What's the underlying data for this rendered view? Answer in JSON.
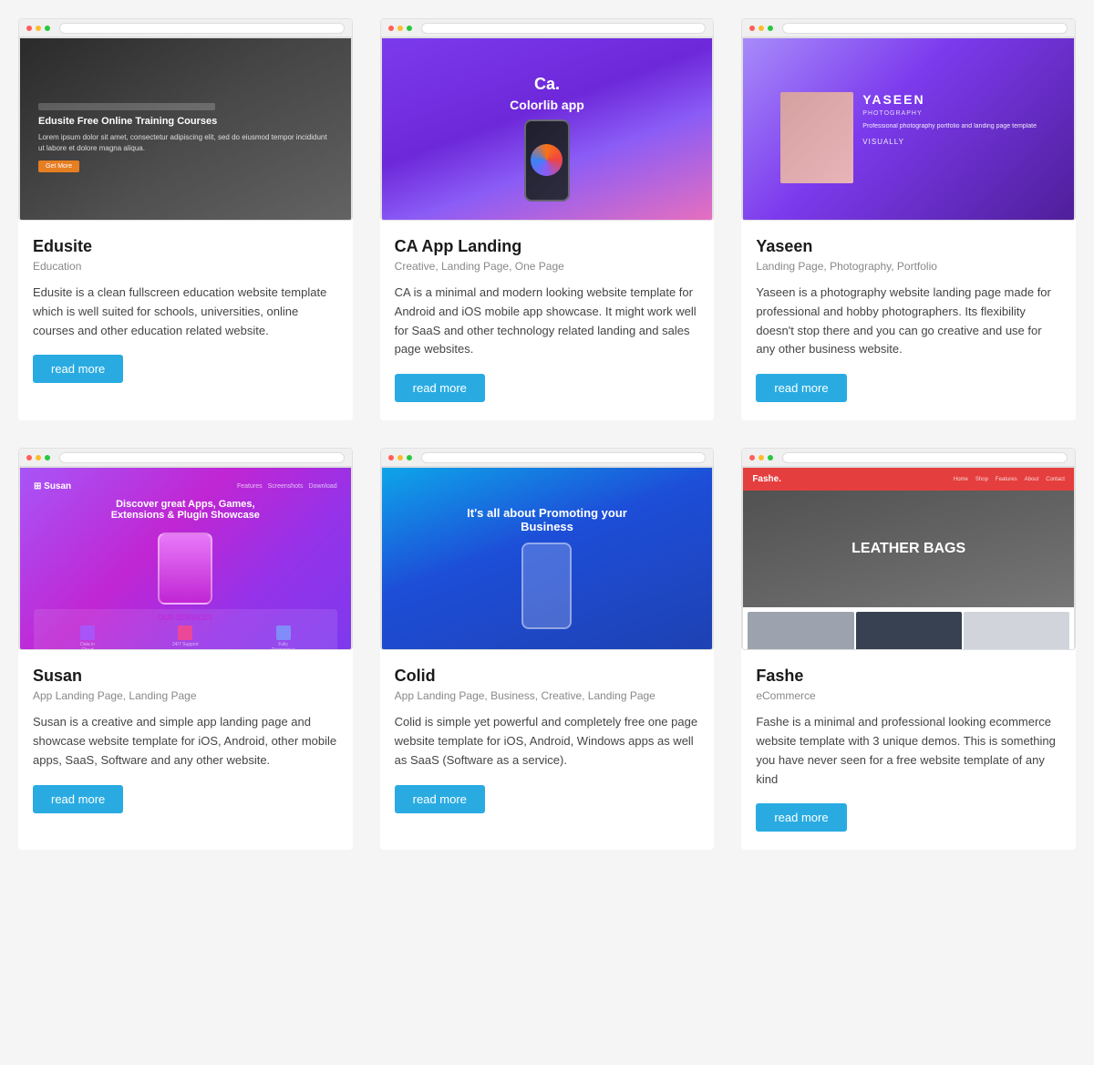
{
  "cards": [
    {
      "id": "edusite",
      "title": "Edusite",
      "categories": "Education",
      "description": "Edusite is a clean fullscreen education website template which is well suited for schools, universities, online courses and other education related website.",
      "read_more": "read more",
      "screenshot_type": "edusite"
    },
    {
      "id": "ca-app-landing",
      "title": "CA App Landing",
      "categories": "Creative, Landing Page, One Page",
      "description": "CA is a minimal and modern looking website template for Android and iOS mobile app showcase. It might work well for SaaS and other technology related landing and sales page websites.",
      "read_more": "read more",
      "screenshot_type": "ca"
    },
    {
      "id": "yaseen",
      "title": "Yaseen",
      "categories": "Landing Page, Photography, Portfolio",
      "description": "Yaseen is a photography website landing page made for professional and hobby photographers. Its flexibility doesn't stop there and you can go creative and use for any other business website.",
      "read_more": "read more",
      "screenshot_type": "yaseen"
    },
    {
      "id": "susan",
      "title": "Susan",
      "categories": "App Landing Page, Landing Page",
      "description": "Susan is a creative and simple app landing page and showcase website template for iOS, Android, other mobile apps, SaaS, Software and any other website.",
      "read_more": "read more",
      "screenshot_type": "susan"
    },
    {
      "id": "colid",
      "title": "Colid",
      "categories": "App Landing Page, Business, Creative, Landing Page",
      "description": "Colid is simple yet powerful and completely free one page website template for iOS, Android, Windows apps as well as SaaS (Software as a service).",
      "read_more": "read more",
      "screenshot_type": "colid"
    },
    {
      "id": "fashe",
      "title": "Fashe",
      "categories": "eCommerce",
      "description": "Fashe is a minimal and professional looking ecommerce website template with 3 unique demos. This is something you have never seen for a free website template of any kind",
      "read_more": "read more",
      "screenshot_type": "fashe"
    }
  ],
  "colors": {
    "read_more_bg": "#29abe2",
    "title_color": "#1a1a1a",
    "category_color": "#888888",
    "desc_color": "#444444"
  }
}
